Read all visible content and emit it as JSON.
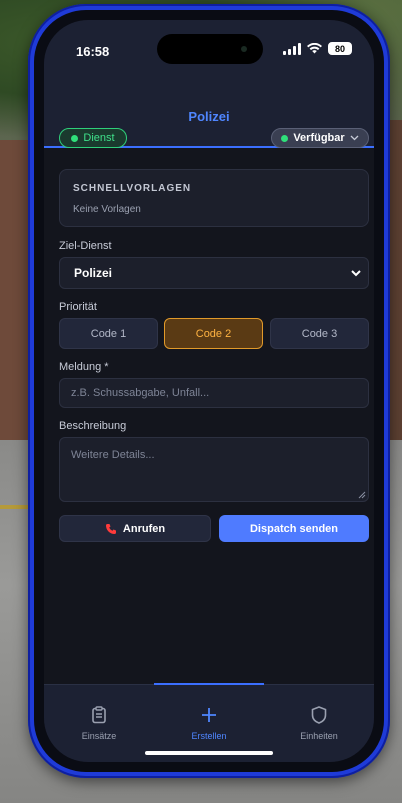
{
  "status": {
    "time": "16:58",
    "battery": "80"
  },
  "header": {
    "title": "Polizei",
    "duty_label": "Dienst",
    "availability_label": "Verfügbar"
  },
  "templates": {
    "title": "SCHNELLVORLAGEN",
    "empty_text": "Keine Vorlagen"
  },
  "form": {
    "target_service_label": "Ziel-Dienst",
    "target_service_value": "Polizei",
    "priority_label": "Priorität",
    "priorities": [
      "Code 1",
      "Code 2",
      "Code 3"
    ],
    "selected_priority": "Code 2",
    "report_label": "Meldung *",
    "report_placeholder": "z.B. Schussabgabe, Unfall...",
    "description_label": "Beschreibung",
    "description_placeholder": "Weitere Details..."
  },
  "actions": {
    "call_label": "Anrufen",
    "send_label": "Dispatch senden"
  },
  "tabs": [
    {
      "label": "Einsätze",
      "icon": "clipboard-icon",
      "active": false
    },
    {
      "label": "Erstellen",
      "icon": "plus-icon",
      "active": true
    },
    {
      "label": "Einheiten",
      "icon": "shield-icon",
      "active": false
    }
  ],
  "colors": {
    "accent": "#4f7bff",
    "duty_green": "#2fe07a",
    "priority_active": "#ffb342",
    "phone_frame": "#1f3bd8"
  }
}
